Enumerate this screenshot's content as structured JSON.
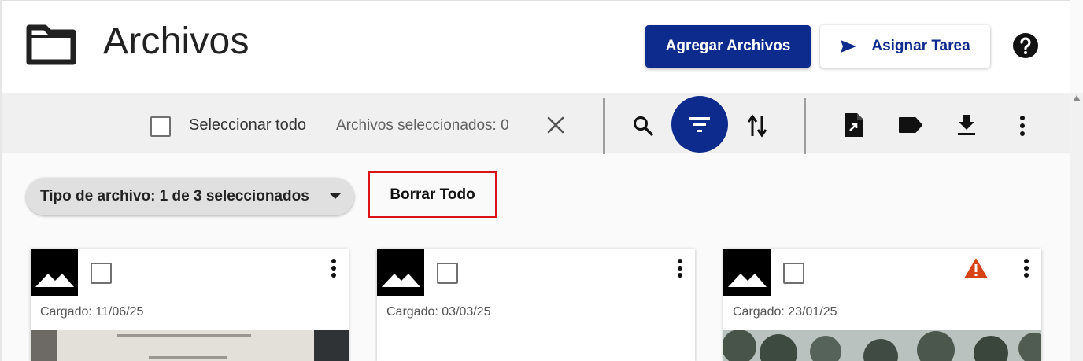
{
  "header": {
    "title": "Archivos",
    "add_files_label": "Agregar Archivos",
    "assign_task_label": "Asignar Tarea",
    "icons": [
      "folder-icon",
      "send-icon",
      "help-icon"
    ]
  },
  "toolbar": {
    "select_all_label": "Seleccionar todo",
    "selected_count_text": "Archivos seleccionados: 0",
    "icons": [
      "clear-selection-icon",
      "search-icon",
      "filter-icon",
      "sort-icon",
      "file-export-icon",
      "tag-icon",
      "download-icon",
      "more-vert-icon"
    ]
  },
  "filters": {
    "file_type_chip_label": "Tipo de archivo: 1 de 3 seleccionados",
    "clear_all_label": "Borrar Todo"
  },
  "cards": [
    {
      "uploaded": "Cargado: 11/06/25",
      "warning": false,
      "preview": "receipt-photo"
    },
    {
      "uploaded": "Cargado: 03/03/25",
      "warning": false,
      "preview": "blank"
    },
    {
      "uploaded": "Cargado: 23/01/25",
      "warning": true,
      "preview": "trees-photo"
    }
  ],
  "colors": {
    "primary": "#0d2b8c",
    "highlight_border": "#d8141a",
    "warning": "#d84315",
    "toolbar_bg": "#f0f0f0"
  }
}
